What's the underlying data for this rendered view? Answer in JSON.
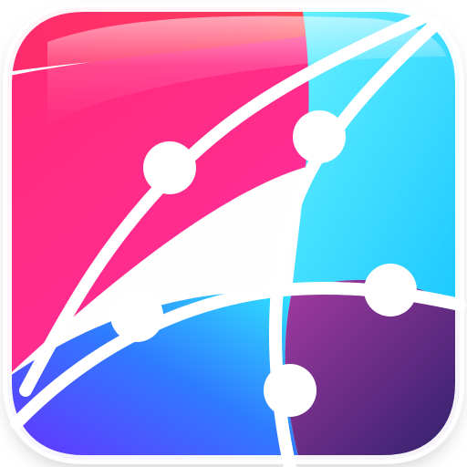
{
  "app_icon": {
    "name": "network-curves-app-icon",
    "colors": {
      "pink": "#ff2a6f",
      "magenta": "#ff2fb3",
      "orange": "#ff7a2a",
      "cyan": "#2fe6ff",
      "blue": "#2f7bff",
      "purple": "#6a2cff",
      "deep_plum": "#3a1d6f",
      "white": "#ffffff"
    },
    "icons": {
      "main": "network-curve-icon"
    }
  }
}
